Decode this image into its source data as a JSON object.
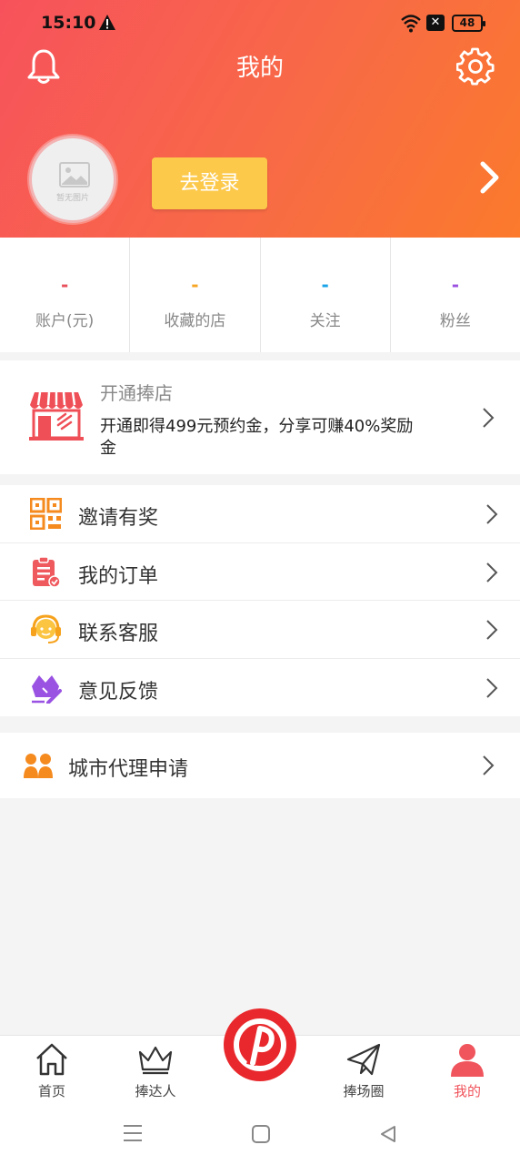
{
  "status_bar": {
    "time": "15:10",
    "battery": "48",
    "sim_icon": "x-box-icon"
  },
  "header": {
    "title": "我的",
    "login_label": "去登录",
    "avatar_caption": "暂无图片"
  },
  "stats": [
    {
      "value": "-",
      "label": "账户(元)",
      "color": "#e8505b"
    },
    {
      "value": "-",
      "label": "收藏的店",
      "color": "#f6a623"
    },
    {
      "value": "-",
      "label": "关注",
      "color": "#1aa3e8"
    },
    {
      "value": "-",
      "label": "粉丝",
      "color": "#9b51e0"
    }
  ],
  "shop": {
    "title": "开通捧店",
    "description": "开通即得499元预约金，分享可赚40%奖励金"
  },
  "menu": [
    {
      "label": "邀请有奖",
      "icon": "qr-code-icon"
    },
    {
      "label": "我的订单",
      "icon": "order-icon"
    },
    {
      "label": "联系客服",
      "icon": "headset-icon"
    },
    {
      "label": "意见反馈",
      "icon": "feedback-icon"
    }
  ],
  "agent": {
    "label": "城市代理申请",
    "icon": "people-icon"
  },
  "bottom_nav": [
    {
      "label": "首页",
      "icon": "home-icon"
    },
    {
      "label": "捧达人",
      "icon": "crown-icon"
    },
    {
      "label": "捧场圈",
      "icon": "paper-plane-icon"
    },
    {
      "label": "我的",
      "icon": "person-icon",
      "active": true
    }
  ],
  "colors": {
    "header_start": "#f7525c",
    "header_end": "#fb7a2c",
    "login_button": "#fcc94b",
    "active_tab": "#f0545c",
    "brand_red": "#e8282c"
  }
}
